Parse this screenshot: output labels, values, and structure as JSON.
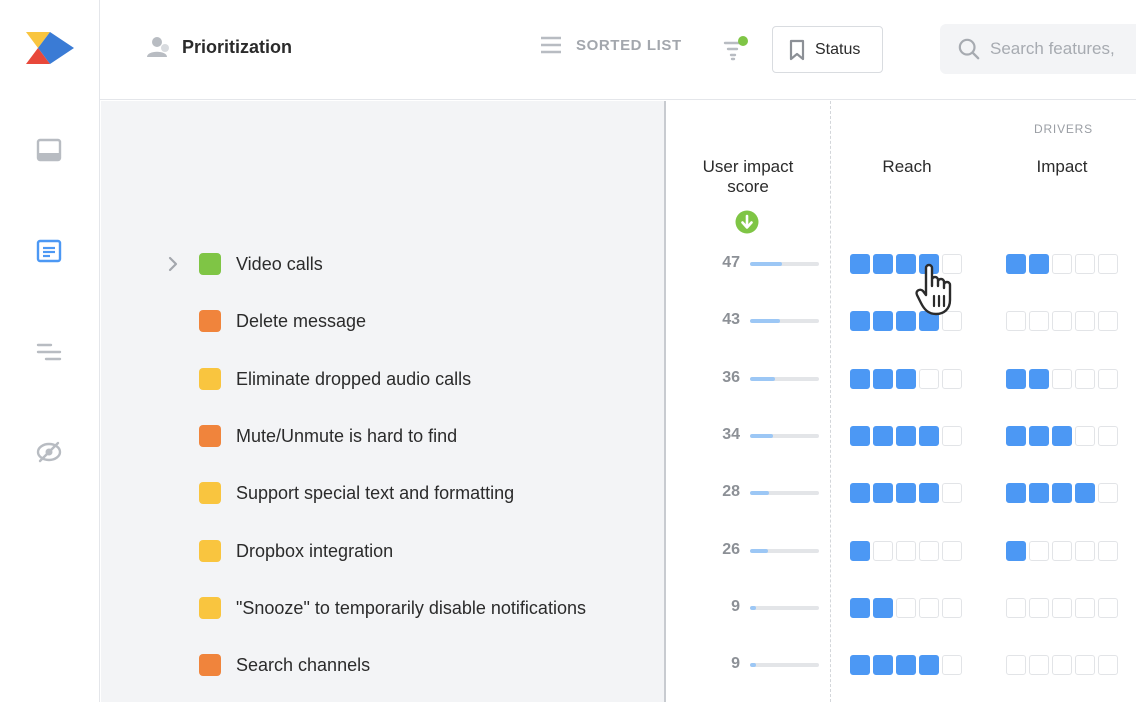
{
  "header": {
    "title": "Prioritization",
    "sorted_list_label": "SORTED LIST",
    "status_label": "Status",
    "search_placeholder": "Search features,"
  },
  "columns": {
    "drivers_label": "DRIVERS",
    "score_label": "User impact score",
    "reach_label": "Reach",
    "impact_label": "Impact"
  },
  "colors": {
    "accent_blue": "#4c98f4",
    "green": "#7fc545",
    "orange": "#f0843c",
    "yellow": "#f9c53f",
    "score_bar": "#9cc7f5"
  },
  "features": [
    {
      "name": "Video calls",
      "color": "green",
      "score": 47,
      "reach": 4,
      "impact": 2,
      "expandable": true
    },
    {
      "name": "Delete message",
      "color": "orange",
      "score": 43,
      "reach": 4,
      "impact": 0,
      "expandable": false
    },
    {
      "name": "Eliminate dropped audio calls",
      "color": "yellow",
      "score": 36,
      "reach": 3,
      "impact": 2,
      "expandable": false
    },
    {
      "name": "Mute/Unmute is hard to find",
      "color": "orange",
      "score": 34,
      "reach": 4,
      "impact": 3,
      "expandable": false
    },
    {
      "name": "Support special text and formatting",
      "color": "yellow",
      "score": 28,
      "reach": 4,
      "impact": 4,
      "expandable": false
    },
    {
      "name": "Dropbox integration",
      "color": "yellow",
      "score": 26,
      "reach": 1,
      "impact": 1,
      "expandable": false
    },
    {
      "name": "\"Snooze\" to temporarily disable notifications",
      "color": "yellow",
      "score": 9,
      "reach": 2,
      "impact": 0,
      "expandable": false
    },
    {
      "name": "Search channels",
      "color": "orange",
      "score": 9,
      "reach": 4,
      "impact": 0,
      "expandable": false
    }
  ]
}
